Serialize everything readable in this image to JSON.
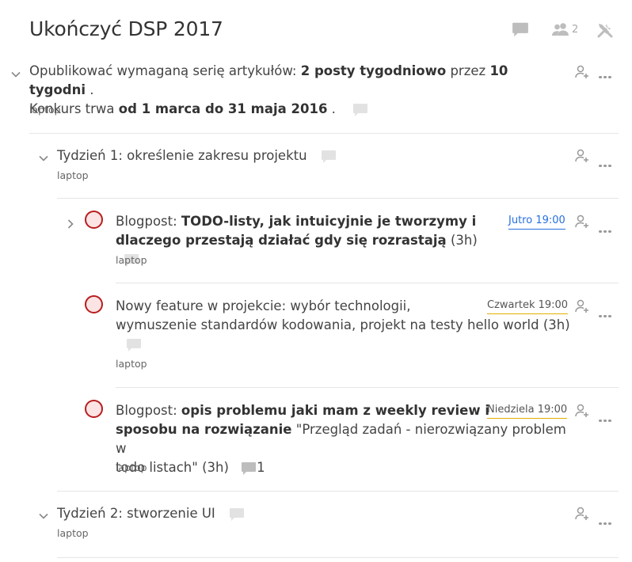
{
  "project": {
    "title": "Ukończyć DSP 2017",
    "members_count": "2"
  },
  "parent_task": {
    "t1": "Opublikować wymaganą serię artykułów: ",
    "b1": "2 posty tygodniowo",
    "t2": " przez ",
    "b2": "10 tygodni",
    "t3": " .",
    "t4": "Konkurs trwa ",
    "b3": "od 1 marca do 31 maja 2016",
    "t5": " .",
    "label": "laptop"
  },
  "week1": {
    "title": "Tydzień 1: określenie zakresu projektu",
    "label": "laptop"
  },
  "task1": {
    "prefix": "Blogpost: ",
    "bold_line1": "TODO-listy, jak intuicyjnie je tworzymy i",
    "bold_line2": "dlaczego przestają działać gdy się rozrastają",
    "suffix": " (3h)",
    "due": "Jutro 19:00",
    "label": "laptop"
  },
  "task2": {
    "line1": "Nowy feature w projekcie: wybór technologii,",
    "line2": "wymuszenie standardów kodowania, projekt na testy hello world (3h)",
    "due": "Czwartek 19:00",
    "label": "laptop"
  },
  "task3": {
    "prefix": "Blogpost: ",
    "bold_line1": "opis problemu jaki mam z weekly review i",
    "bold_line2a": "sposobu na rozwiązanie",
    "line2b": " \"Przegląd zadań - nierozwiązany problem w",
    "line3": "todo listach\" (3h)",
    "comment_count": "1",
    "due": "Niedziela 19:00",
    "label": "laptop"
  },
  "week2": {
    "title": "Tydzień 2: stworzenie UI",
    "label": "laptop"
  },
  "colors": {
    "priority_red": "#b81e1e",
    "due_tomorrow": "#246fe0",
    "due_later": "#e0b000"
  },
  "icons": [
    "comment-icon",
    "people-icon",
    "settings-icon",
    "chevron-down-icon",
    "chevron-right-icon",
    "assign-user-icon",
    "more-icon"
  ]
}
